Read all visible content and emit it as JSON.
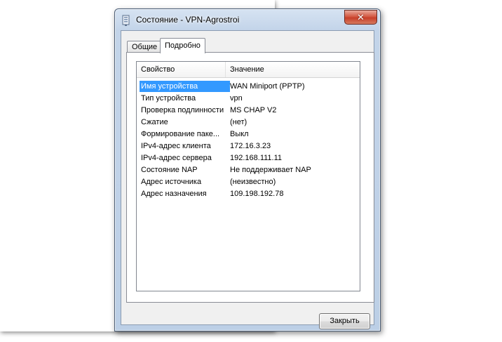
{
  "dialog": {
    "title": "Состояние - VPN-Agrostroi",
    "close_glyph": "✕"
  },
  "tabs": [
    {
      "label": "Общие",
      "active": false
    },
    {
      "label": "Подробно",
      "active": true
    }
  ],
  "details": {
    "columns": [
      "Свойство",
      "Значение"
    ],
    "rows": [
      {
        "property": "Имя устройства",
        "value": "WAN Miniport (PPTP)",
        "selected": true
      },
      {
        "property": "Тип устройства",
        "value": "vpn"
      },
      {
        "property": "Проверка подлинности",
        "value": "MS CHAP V2"
      },
      {
        "property": "Сжатие",
        "value": "(нет)"
      },
      {
        "property": "Формирование паке...",
        "value": "Выкл"
      },
      {
        "property": "IPv4-адрес клиента",
        "value": "172.16.3.23"
      },
      {
        "property": "IPv4-адрес сервера",
        "value": "192.168.111.11"
      },
      {
        "property": "Состояние NAP",
        "value": "Не поддерживает NAP"
      },
      {
        "property": "Адрес источника",
        "value": "(неизвестно)"
      },
      {
        "property": "Адрес назначения",
        "value": "109.198.192.78"
      }
    ]
  },
  "buttons": {
    "close_label": "Закрыть"
  },
  "icons": {
    "title": "network-connection-icon",
    "close": "close-icon"
  },
  "colors": {
    "selection": "#3399ff",
    "close_button": "#c7402a"
  }
}
